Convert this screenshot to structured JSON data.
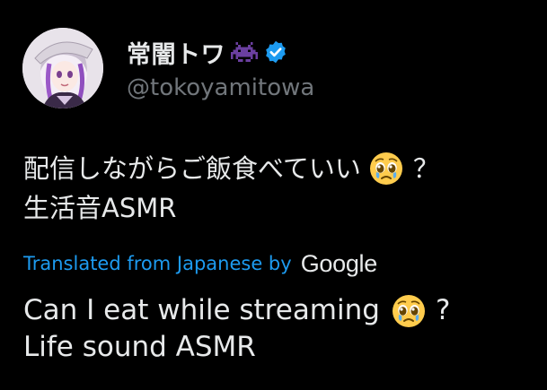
{
  "author": {
    "display_name": "常闇トワ",
    "handle": "@tokoyamitowa",
    "badges": [
      "space-invader-icon",
      "verified-badge-icon"
    ],
    "verified_color": "#1d9bf0",
    "invader_color": "#6b3fa0"
  },
  "post": {
    "line1": "配信しながらご飯食べていい",
    "line1_emoji": "pleading-face-emoji",
    "line1_end": "？",
    "line2": "生活音ASMR"
  },
  "translation": {
    "label": "Translated from Japanese by",
    "provider": "Google",
    "line1": "Can I eat while streaming",
    "line1_emoji": "pleading-face-emoji",
    "line1_end": "?",
    "line2": "Life sound ASMR",
    "link_color": "#1d9bf0"
  },
  "theme": {
    "background": "#000000",
    "text": "#e7e9ea",
    "muted": "#71767b"
  }
}
